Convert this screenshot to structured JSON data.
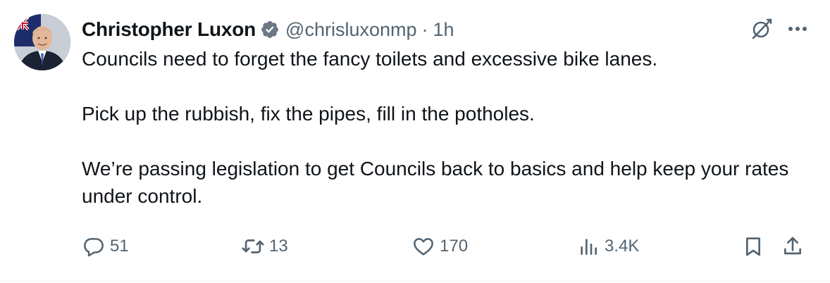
{
  "author": {
    "display_name": "Christopher Luxon",
    "handle": "@chrisluxonmp",
    "separator": "·",
    "timestamp": "1h",
    "verified_icon": "verified-badge-icon",
    "verified_color": "#6b7785"
  },
  "tweet": {
    "paragraphs": [
      "Councils need to forget the fancy toilets and excessive bike lanes.",
      "Pick up the rubbish, fix the pipes, fill in the potholes.",
      "We’re passing legislation to get Councils back to basics and help keep your rates under control."
    ]
  },
  "actions": {
    "reply": {
      "icon": "reply-icon",
      "count": "51"
    },
    "retweet": {
      "icon": "retweet-icon",
      "count": "13"
    },
    "like": {
      "icon": "heart-icon",
      "count": "170"
    },
    "views": {
      "icon": "views-icon",
      "count": "3.4K"
    },
    "bookmark": {
      "icon": "bookmark-icon"
    },
    "share": {
      "icon": "share-icon"
    }
  },
  "header_buttons": {
    "grok": {
      "icon": "grok-icon"
    },
    "more": {
      "icon": "more-icon"
    }
  },
  "colors": {
    "text_primary": "#0f1419",
    "text_secondary": "#536471",
    "divider": "#eff3f4"
  }
}
